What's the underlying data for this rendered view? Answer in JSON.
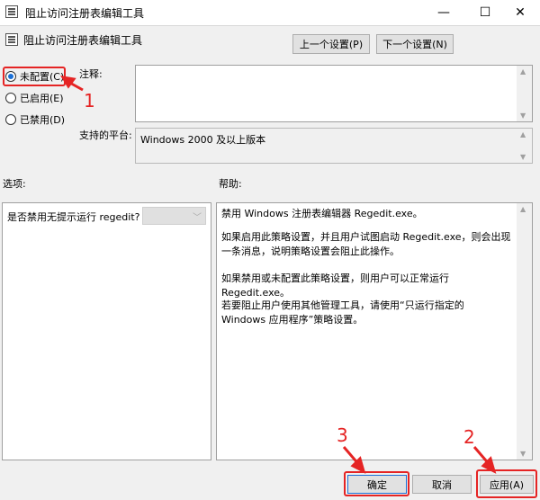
{
  "window": {
    "title": "阻止访问注册表编辑工具",
    "icon": "policy-icon",
    "controls": {
      "minimize": "—",
      "maximize": "☐",
      "close": "✕"
    }
  },
  "header": {
    "setting_title": "阻止访问注册表编辑工具",
    "prev_label": "上一个设置(P)",
    "next_label": "下一个设置(N)"
  },
  "radios": {
    "not_configured": "未配置(C)",
    "enabled": "已启用(E)",
    "disabled": "已禁用(D)",
    "selected": "not_configured"
  },
  "labels": {
    "comment": "注释:",
    "platform": "支持的平台:",
    "options": "选项:",
    "help": "帮助:"
  },
  "comment_value": "",
  "platform_value": "Windows 2000 及以上版本",
  "options": {
    "label": "是否禁用无提示运行 regedit?",
    "selected_value": ""
  },
  "help": {
    "p1": "禁用 Windows 注册表编辑器 Regedit.exe。",
    "p2": "如果启用此策略设置，并且用户试图启动 Regedit.exe，则会出现一条消息，说明策略设置会阻止此操作。",
    "p3": "如果禁用或未配置此策略设置，则用户可以正常运行 Regedit.exe。",
    "p4": "若要阻止用户使用其他管理工具，请使用“只运行指定的 Windows 应用程序”策略设置。"
  },
  "footer": {
    "ok": "确定",
    "cancel": "取消",
    "apply": "应用(A)"
  },
  "annotations": {
    "step1": "1",
    "step2": "2",
    "step3": "3",
    "color": "#e52424"
  },
  "colors": {
    "accent": "#1a6fd6",
    "window_bg": "#f0f0f0"
  }
}
